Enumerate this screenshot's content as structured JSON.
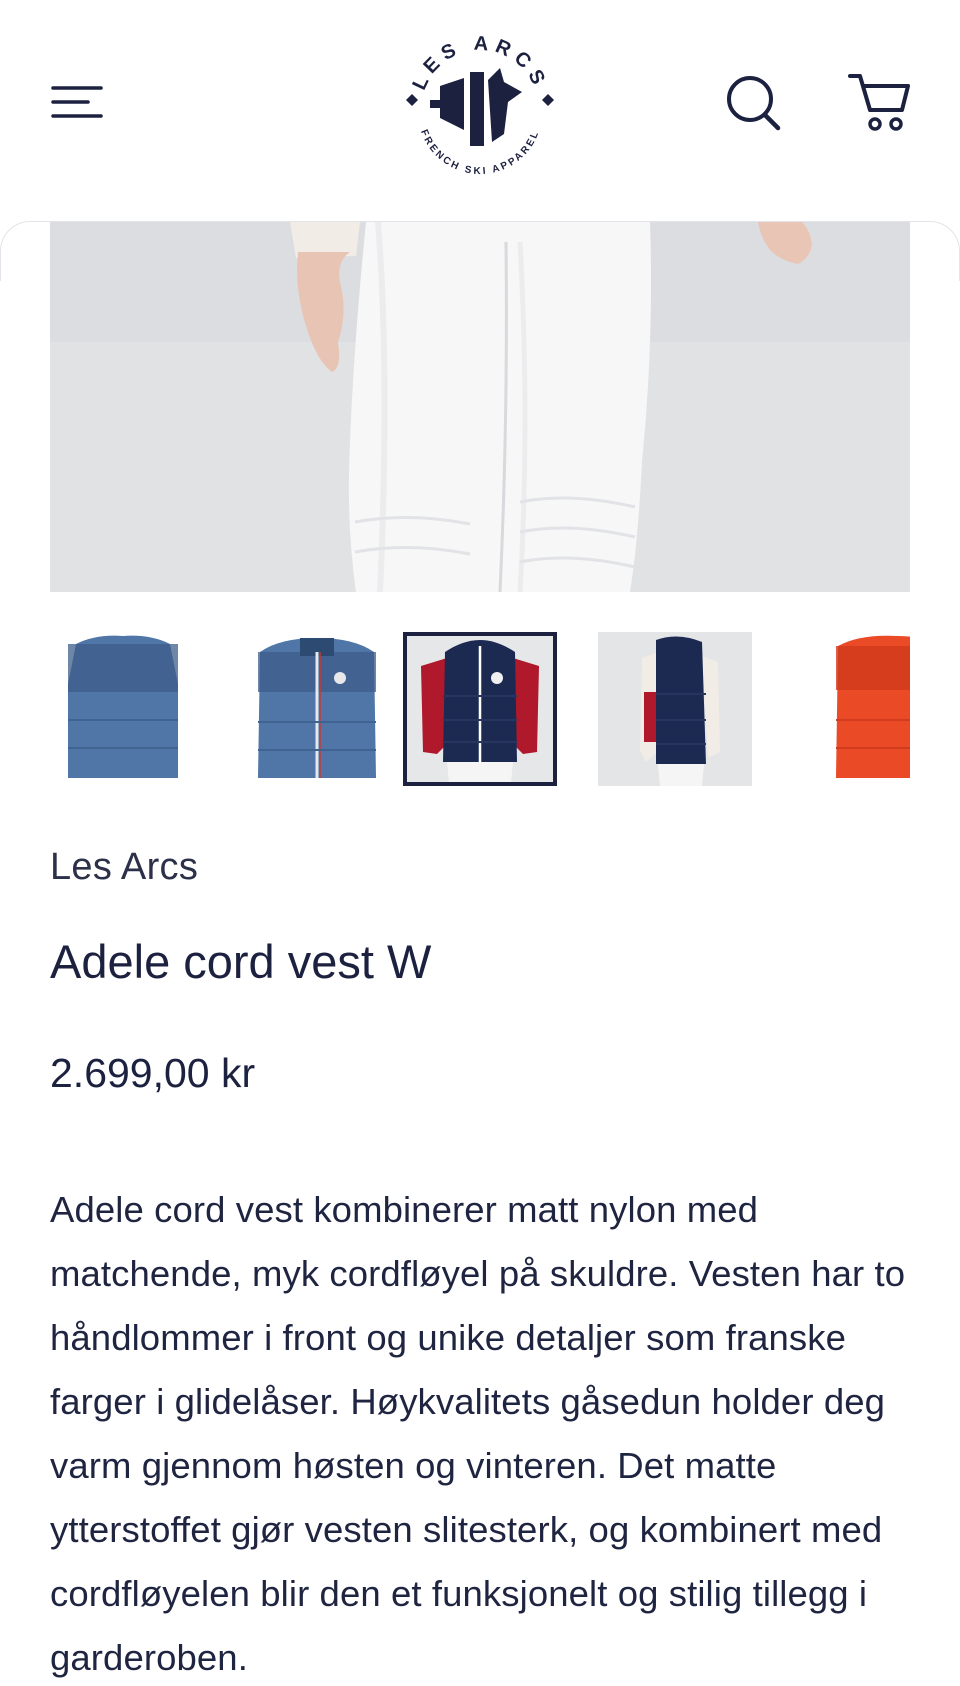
{
  "header": {
    "menu_icon": "hamburger-menu-icon",
    "logo_top_text": "LES ARCS",
    "logo_bottom_text": "FRENCH SKI APPAREL",
    "search_icon": "search-icon",
    "cart_icon": "cart-icon"
  },
  "gallery": {
    "thumbnails": [
      {
        "color": "#4f76a6",
        "selected": false
      },
      {
        "color": "#4f76a6",
        "selected": false
      },
      {
        "color": "#1c2a52",
        "selected": true
      },
      {
        "color": "#1c2a52",
        "selected": false
      },
      {
        "color": "#ea4a25",
        "selected": false
      }
    ]
  },
  "product": {
    "brand": "Les Arcs",
    "title": "Adele cord vest W",
    "price": "2.699,00 kr",
    "description": "Adele cord vest kombinerer matt nylon med matchende, myk cordfløyel på skuldre. Vesten har to håndlommer i front og unike detaljer som franske farger i glidelåser. Høykvalitets gåsedun holder deg varm gjennom høsten og vinteren. Det matte ytterstoffet gjør vesten slitesterk, og kombinert med cordfløyelen blir den et funksjonelt og stilig tillegg i garderoben."
  },
  "colors": {
    "text_primary": "#1c2140",
    "selected_border": "#1c2140",
    "image_background": "#e2e3e5"
  }
}
